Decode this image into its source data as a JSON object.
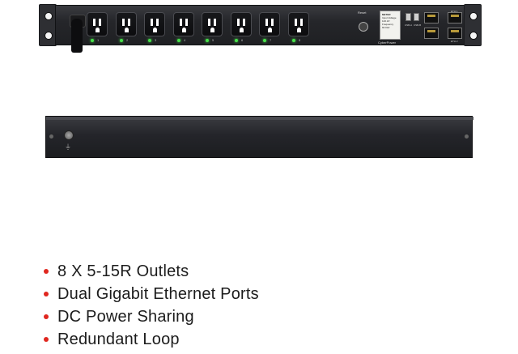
{
  "product": {
    "brand_label": "CyberPower",
    "reset_label": "Reset",
    "display": {
      "header": "METER",
      "line1": "Input Voltage",
      "line2": "120.2V",
      "line3": "Frequency",
      "line4": "60.0Hz"
    },
    "outlets": [
      "1",
      "2",
      "3",
      "4",
      "5",
      "6",
      "7",
      "8"
    ],
    "ports": {
      "usb_a": "USB-A",
      "usb_b": "USB-B",
      "eth1": "ETH 1",
      "eth2": "ETH 2"
    }
  },
  "features": [
    "8 X 5-15R Outlets",
    "Dual Gigabit Ethernet Ports",
    "DC Power Sharing",
    "Redundant Loop"
  ],
  "colors": {
    "bullet": "#e0271f",
    "chassis": "#25262a",
    "led": "#47e04a"
  }
}
